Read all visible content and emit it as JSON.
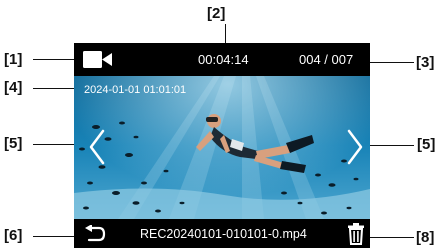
{
  "callouts": {
    "c1": "[1]",
    "c2": "[2]",
    "c3": "[3]",
    "c4": "[4]",
    "c5_left": "[5]",
    "c5_right": "[5]",
    "c6": "[6]",
    "c8": "[8]"
  },
  "playback": {
    "mode_icon": "video-camera-icon",
    "elapsed_time": "00:04:14",
    "file_counter": "004 / 007",
    "recorded_timestamp": "2024-01-01 01:01:01",
    "prev_icon": "chevron-left-icon",
    "next_icon": "chevron-right-icon",
    "back_icon": "back-arrow-icon",
    "filename": "REC20240101-010101-0.mp4",
    "delete_icon": "trash-icon"
  },
  "colors": {
    "bar_background": "#000000",
    "bar_text": "#ffffff",
    "water_top": "#0e6a98",
    "water_bottom": "#5fb1d8"
  }
}
